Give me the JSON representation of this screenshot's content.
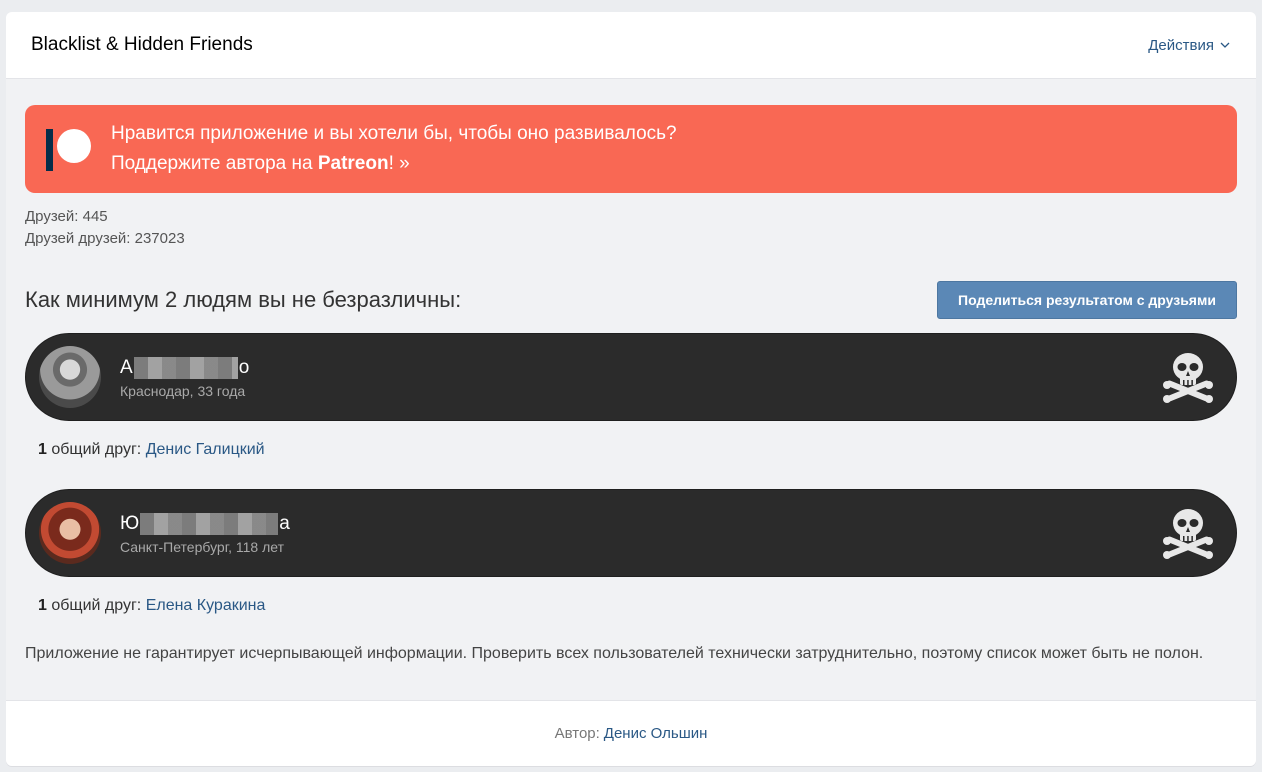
{
  "header": {
    "title": "Blacklist & Hidden Friends",
    "actions_label": "Действия"
  },
  "banner": {
    "line1": "Нравится приложение и вы хотели бы, чтобы оно развивалось?",
    "line2_prefix": "Поддержите автора на ",
    "line2_brand": "Patreon",
    "line2_suffix": "! »",
    "brand_color": "#f96854"
  },
  "stats": {
    "friends": "Друзей: 445",
    "friends_of_friends": "Друзей друзей: 237023"
  },
  "section": {
    "title": "Как минимум 2 людям вы не безразличны:",
    "share_label": "Поделиться результатом с друзьями"
  },
  "users": [
    {
      "name_start": "А",
      "name_end": "о",
      "meta": "Краснодар, 33 года",
      "mutual_count": "1",
      "mutual_label": " общий друг: ",
      "mutual_friend": "Денис Галицкий",
      "icon": "skull-crossbones-icon"
    },
    {
      "name_start": "Ю",
      "name_end": "а",
      "meta": "Санкт-Петербург, 118 лет",
      "mutual_count": "1",
      "mutual_label": " общий друг: ",
      "mutual_friend": "Елена Куракина",
      "icon": "skull-crossbones-icon"
    }
  ],
  "disclaimer": "Приложение не гарантирует исчерпывающей информации. Проверить всех пользователей технически затруднительно, поэтому список может быть не полон.",
  "footer": {
    "author_label": "Автор:",
    "author_name": "Денис Ольшин"
  }
}
